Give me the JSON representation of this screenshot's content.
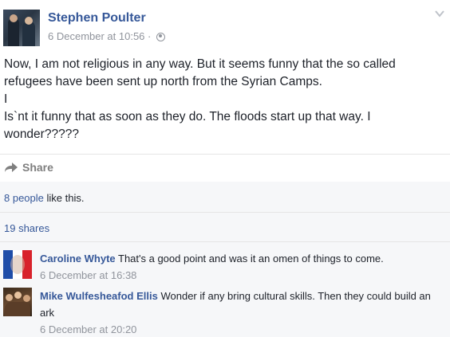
{
  "post": {
    "author": "Stephen Poulter",
    "timestamp": "6 December at 10:56 ·",
    "icons": {
      "privacy": "globe-icon",
      "menu": "chevron-down-icon",
      "share": "share-arrow-icon"
    },
    "body_lines": [
      "Now, I am not religious in any way. But it seems funny that the so called refugees have been sent up north from the Syrian Camps.",
      "I",
      "Is`nt it funny that as soon as they do. The floods start up that way. I wonder?????"
    ],
    "share_label": "Share"
  },
  "feedback": {
    "likes_link": "8 people",
    "likes_suffix": " like this.",
    "shares": "19 shares"
  },
  "comments": [
    {
      "author": "Caroline Whyte",
      "text": " That's a good point and was it an omen of things to come.",
      "time": "6 December at 16:38",
      "avatar": "french-flag-avatar"
    },
    {
      "author": "Mike Wulfesheafod Ellis",
      "text": " Wonder if any bring cultural skills. Then they could build an ark",
      "time": "6 December at 20:20",
      "avatar": "group-photo-avatar"
    }
  ],
  "colors": {
    "link": "#365899",
    "muted": "#90949c",
    "text": "#1d2129",
    "feedback_bg": "#f6f7f9"
  }
}
